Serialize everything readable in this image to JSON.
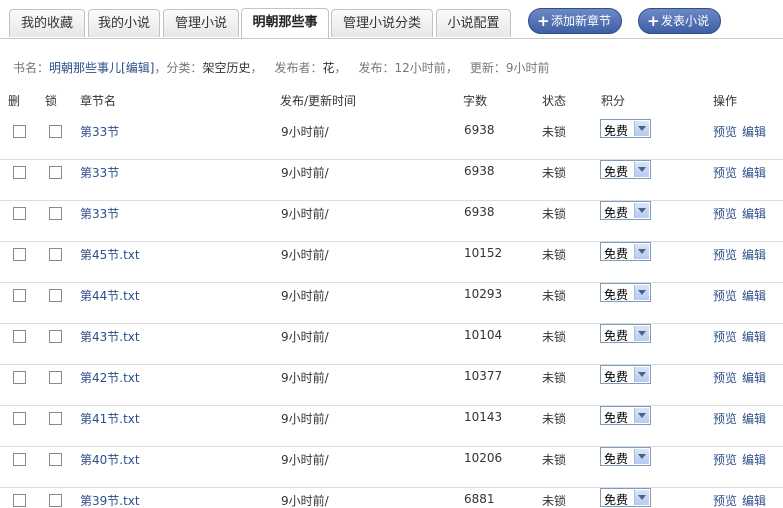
{
  "tabs": [
    {
      "label": "我的收藏",
      "active": false
    },
    {
      "label": "我的小说",
      "active": false
    },
    {
      "label": "管理小说",
      "active": false
    },
    {
      "label": "明朝那些事",
      "active": true
    },
    {
      "label": "管理小说分类",
      "active": false
    },
    {
      "label": "小说配置",
      "active": false
    }
  ],
  "actions": {
    "add_chapter": "添加新章节",
    "publish_novel": "发表小说"
  },
  "info": {
    "book_label": "书名：",
    "book_name": "明朝那些事儿",
    "edit_link": "[编辑]",
    "sep1": "，",
    "category_label": "分类：",
    "category": "架空历史",
    "sep2": "，",
    "publisher_label": "发布者：",
    "publisher": "花",
    "sep3": "，",
    "published_label": "发布：",
    "published": "12小时前",
    "sep4": "，",
    "updated_label": "更新：",
    "updated": "9小时前"
  },
  "columns": {
    "delete": "删",
    "lock": "锁",
    "chapter": "章节名",
    "time": "发布/更新时间",
    "words": "字数",
    "status": "状态",
    "points": "积分",
    "ops": "操作"
  },
  "row_labels": {
    "preview": "预览",
    "edit": "编辑"
  },
  "rows": [
    {
      "title": "第33节",
      "time": "9小时前/",
      "words": "6938",
      "status": "未锁",
      "points": "免费"
    },
    {
      "title": "第33节",
      "time": "9小时前/",
      "words": "6938",
      "status": "未锁",
      "points": "免费"
    },
    {
      "title": "第33节",
      "time": "9小时前/",
      "words": "6938",
      "status": "未锁",
      "points": "免费"
    },
    {
      "title": "第45节.txt",
      "time": "9小时前/",
      "words": "10152",
      "status": "未锁",
      "points": "免费"
    },
    {
      "title": "第44节.txt",
      "time": "9小时前/",
      "words": "10293",
      "status": "未锁",
      "points": "免费"
    },
    {
      "title": "第43节.txt",
      "time": "9小时前/",
      "words": "10104",
      "status": "未锁",
      "points": "免费"
    },
    {
      "title": "第42节.txt",
      "time": "9小时前/",
      "words": "10377",
      "status": "未锁",
      "points": "免费"
    },
    {
      "title": "第41节.txt",
      "time": "9小时前/",
      "words": "10143",
      "status": "未锁",
      "points": "免费"
    },
    {
      "title": "第40节.txt",
      "time": "9小时前/",
      "words": "10206",
      "status": "未锁",
      "points": "免费"
    },
    {
      "title": "第39节.txt",
      "time": "9小时前/",
      "words": "6881",
      "status": "未锁",
      "points": "免费"
    }
  ]
}
